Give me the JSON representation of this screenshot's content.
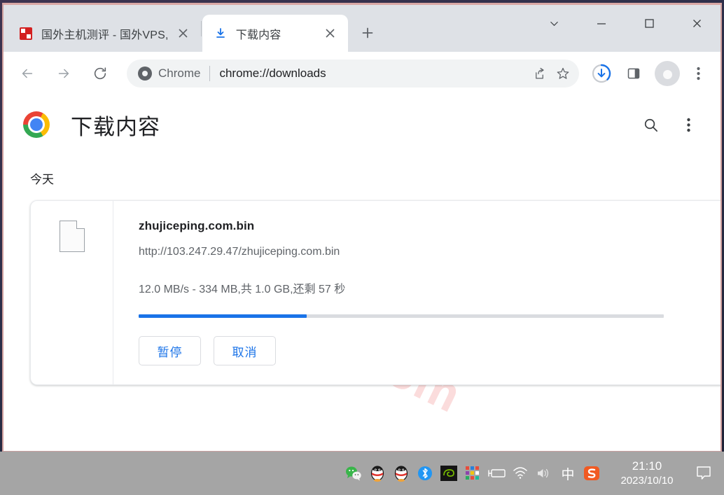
{
  "window": {
    "controls": [
      {
        "name": "tab-search-button",
        "glyph": "chevron-down"
      },
      {
        "name": "minimize-button",
        "glyph": "minimize"
      },
      {
        "name": "maximize-button",
        "glyph": "maximize"
      },
      {
        "name": "close-button",
        "glyph": "close"
      }
    ]
  },
  "tabs": [
    {
      "title": "国外主机测评 - 国外VPS,",
      "favicon": "red-seal-icon",
      "active": false
    },
    {
      "title": "下载内容",
      "favicon": "download-icon",
      "active": true
    }
  ],
  "new_tab_label": "+",
  "toolbar": {
    "back_label": "←",
    "forward_label": "→",
    "reload_label": "⟳",
    "chrome_badge": "Chrome",
    "url": "chrome://downloads",
    "share_icon": "share-icon",
    "bookmark_icon": "star-icon",
    "downloads_icon": "download-progress-icon",
    "sidepanel_icon": "side-panel-icon",
    "avatar_icon": "profile-avatar-icon",
    "menu_icon": "three-dot-menu-icon"
  },
  "page": {
    "watermark": "zhujiceping.com",
    "title": "下载内容",
    "logo": "chrome-logo",
    "search_icon": "search-icon",
    "menu_icon": "three-dot-menu-icon",
    "date_group": "今天"
  },
  "download": {
    "file_icon": "generic-file-icon",
    "file_name": "zhujiceping.com.bin",
    "url": "http://103.247.29.47/zhujiceping.com.bin",
    "status": "12.0 MB/s - 334 MB,共 1.0 GB,还剩 57 秒",
    "progress_percent": 32,
    "pause_label": "暂停",
    "cancel_label": "取消"
  },
  "taskbar": {
    "tray_icons": [
      "wechat-icon",
      "qq-icon",
      "qq-icon",
      "bluetooth-icon",
      "nvidia-icon",
      "colored-grid-icon",
      "battery-icon",
      "wifi-icon",
      "volume-icon"
    ],
    "ime_label": "中",
    "sogou_label": "S",
    "time": "21:10",
    "date": "2023/10/10",
    "notification_icon": "notification-icon"
  },
  "colors": {
    "accent": "#1a73e8",
    "progress_track": "#dadce0",
    "chrome_blue": "#4285f4",
    "watermark": "#fbdcdc",
    "taskbar": "#a5a5a5"
  }
}
